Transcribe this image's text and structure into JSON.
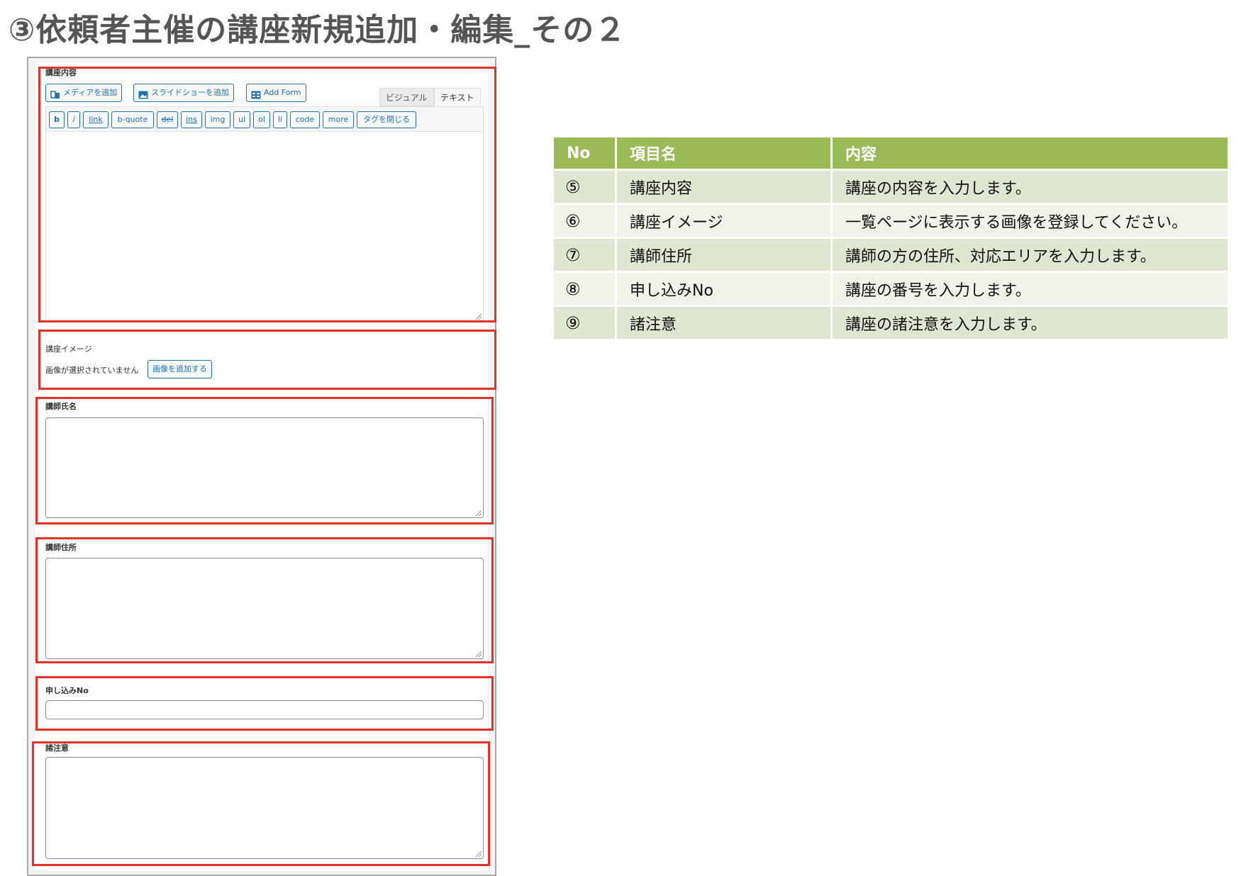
{
  "page_title": "③依頼者主催の講座新規追加・編集_その２",
  "form": {
    "content_label": "講座内容",
    "add_media": "メディアを追加",
    "add_slideshow": "スライドショーを追加",
    "add_form": "Add Form",
    "tab_visual": "ビジュアル",
    "tab_text": "テキスト",
    "quicktags": [
      "b",
      "i",
      "link",
      "b-quote",
      "del",
      "ins",
      "img",
      "ul",
      "ol",
      "li",
      "code",
      "more",
      "タグを閉じる"
    ],
    "image_label": "講座イメージ",
    "no_image_text": "画像が選択されていません",
    "add_image_button": "画像を追加する",
    "instructor_name_label": "講師氏名",
    "instructor_address_label": "講師住所",
    "application_no_label": "申し込みNo",
    "notes_label": "諸注意"
  },
  "table": {
    "headers": [
      "No",
      "項目名",
      "内容"
    ],
    "rows": [
      {
        "no": "⑤",
        "item": "講座内容",
        "content": "講座の内容を入力します。"
      },
      {
        "no": "⑥",
        "item": "講座イメージ",
        "content": "一覧ページに表示する画像を登録してください。"
      },
      {
        "no": "⑦",
        "item": "講師住所",
        "content": "講師の方の住所、対応エリアを入力します。"
      },
      {
        "no": "⑧",
        "item": "申し込みNo",
        "content": "講座の番号を入力します。"
      },
      {
        "no": "⑨",
        "item": "諸注意",
        "content": "講座の諸注意を入力します。"
      }
    ]
  },
  "colors": {
    "title": "#555555",
    "highlight_border": "#e1332a",
    "table_header": "#9bbb59",
    "row_odd": "#dfe7d3",
    "row_even": "#eff3ea",
    "wp_link_blue": "#2271b1"
  }
}
